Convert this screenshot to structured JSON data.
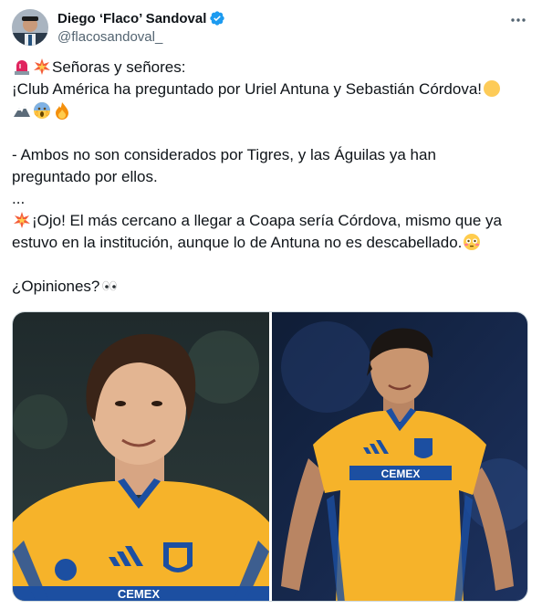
{
  "author": {
    "display_name": "Diego ‘Flaco’ Sandoval",
    "handle": "@flacosandoval_",
    "verified": true
  },
  "tweet": {
    "lines": [
      "Señoras y señores:",
      "¡Club América ha preguntado por Uriel Antuna y Sebastián Córdova!",
      "",
      "",
      "- Ambos no son considerados por Tigres, y las Águilas ya han",
      "preguntado por ellos.",
      "...",
      "¡Ojo! El más cercano a llegar a Coapa sería Córdova, mismo que ya",
      "estuvo en la institución, aunque lo de Antuna no es descabellado.",
      "",
      "¿Opiniones?"
    ],
    "icons": {
      "line0_prefix": [
        "rotating-light-icon",
        "collision-icon"
      ],
      "line1_suffix": [
        "yellow-circle-icon"
      ],
      "line2": [
        "eagle-icon",
        "screaming-face-icon",
        "fire-icon"
      ],
      "line7_prefix": [
        "collision-icon"
      ],
      "line8_suffix": [
        "flushed-face-icon"
      ],
      "line10_suffix": [
        "eyes-icon"
      ]
    }
  },
  "media": {
    "photos": [
      {
        "label": "Sebastián Córdova in Tigres jersey",
        "sponsor_text": "CEMEX",
        "brand": "adidas"
      },
      {
        "label": "Uriel Antuna in Tigres jersey",
        "sponsor_text": "CEMEX",
        "brand": "adidas"
      }
    ]
  },
  "colors": {
    "text": "#0f1419",
    "secondary": "#536471",
    "verified_blue": "#1d9bf0",
    "tigres_gold": "#f6b32a",
    "tigres_blue": "#1c4fa1"
  }
}
